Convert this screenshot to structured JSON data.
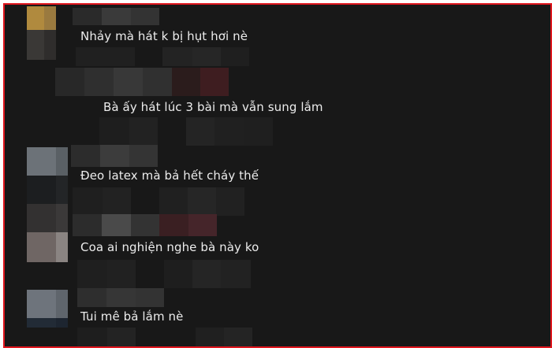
{
  "comments": [
    {
      "text": "Nhảy mà hát k bị hụt hơi nè"
    },
    {
      "text": "Bà ấy hát lúc 3 bài mà vẫn sung lắm"
    },
    {
      "text": "Đeo latex mà bả hết cháy thế"
    },
    {
      "text": "Coa ai nghiện nghe bà này ko"
    },
    {
      "text": "Tui mê bả lắm nè"
    }
  ],
  "colors": {
    "background": "#181818",
    "text": "#ececec",
    "frame_border": "#e0161e"
  }
}
